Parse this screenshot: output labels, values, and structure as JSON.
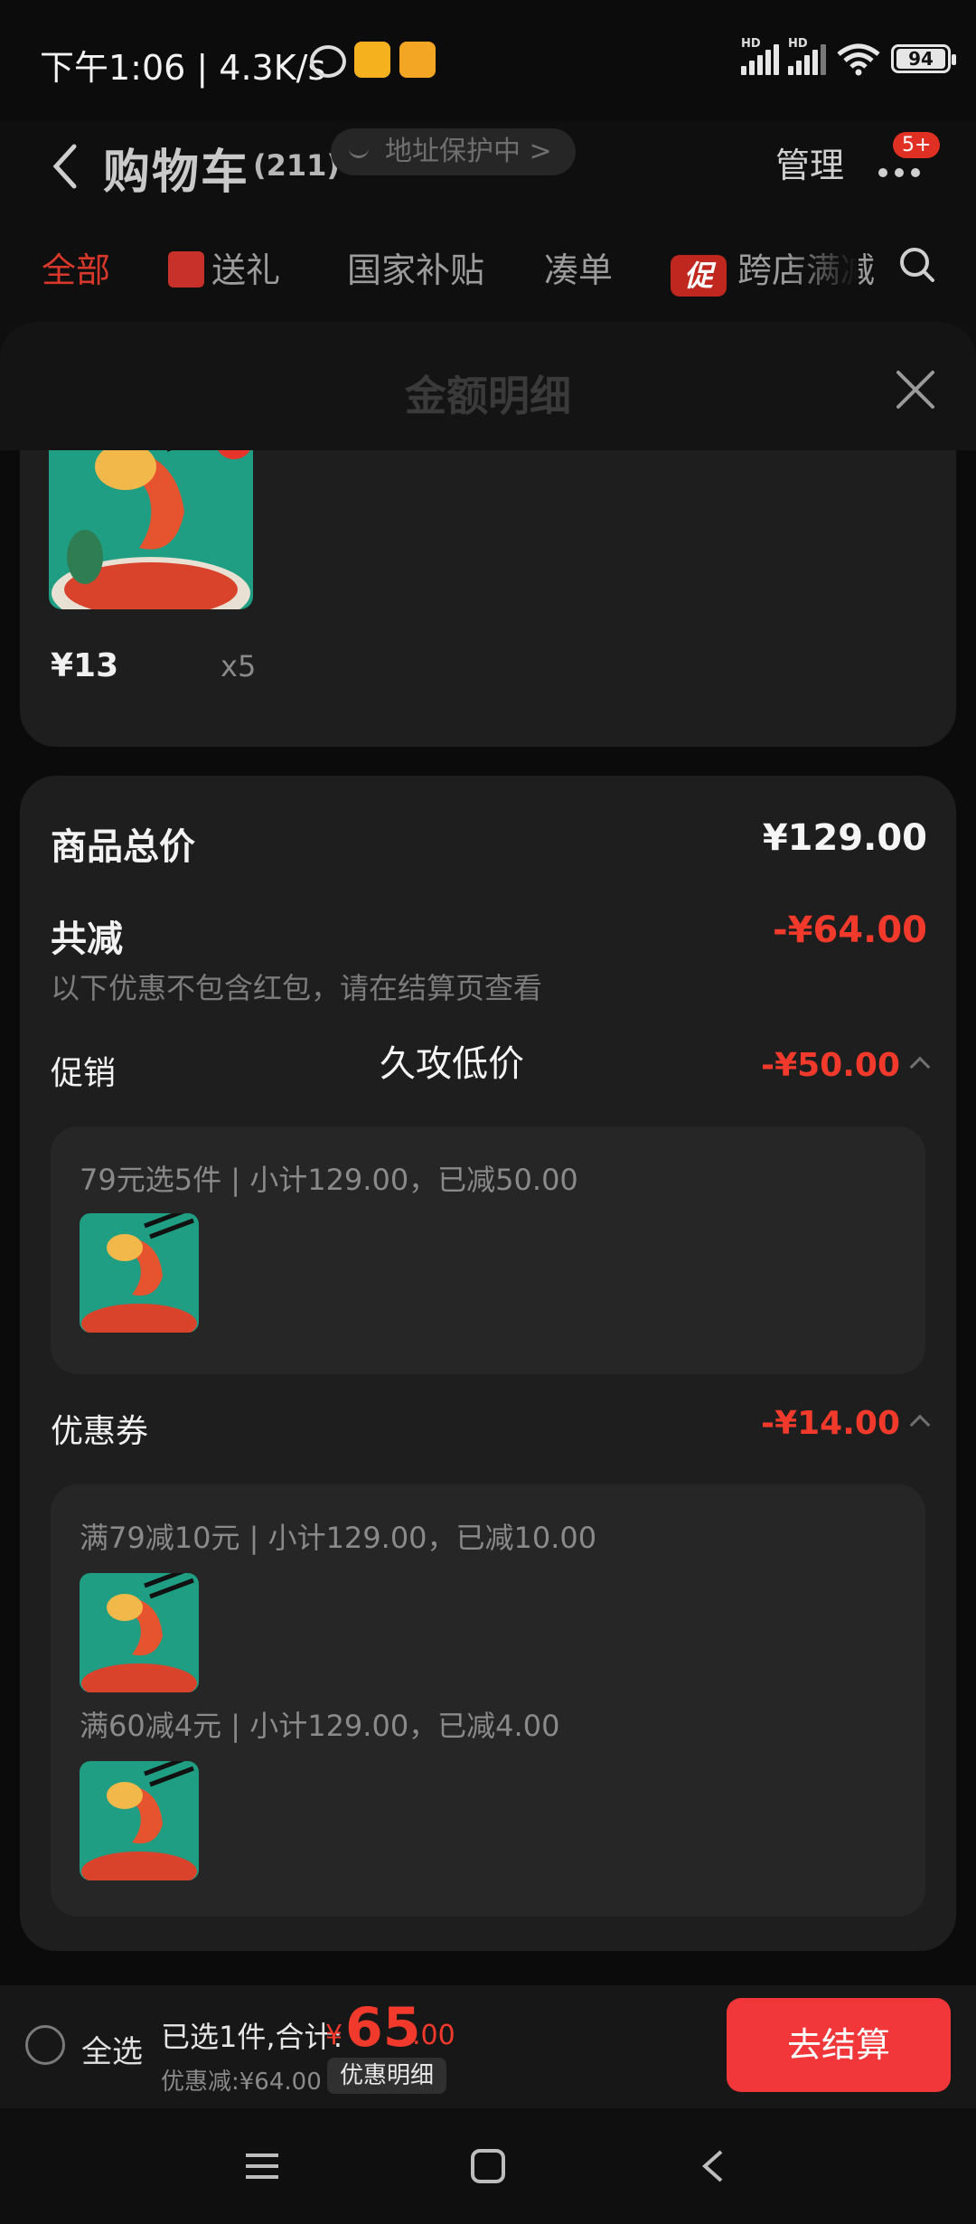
{
  "status_bar": {
    "time_and_speed": "下午1:06 | 4.3K/s",
    "battery": "94"
  },
  "header": {
    "title": "购物车",
    "count": "(211)",
    "address_protection": "地址保护中 >",
    "manage": "管理",
    "badge": "5+"
  },
  "tabs": [
    {
      "label": "全部"
    },
    {
      "label": "送礼"
    },
    {
      "label": "国家补贴"
    },
    {
      "label": "凑单"
    },
    {
      "label": "跨店满减",
      "chip": "促"
    }
  ],
  "sheet": {
    "title": "金额明细",
    "item": {
      "price": "¥13",
      "qty": "x5"
    },
    "total_label": "商品总价",
    "total_value": "¥129.00",
    "reduce_label": "共减",
    "reduce_value": "-¥64.00",
    "reduce_note": "以下优惠不包含红包，请在结算页查看",
    "floating_text": "久攻低价",
    "promo_label": "促销",
    "promo_value": "-¥50.00",
    "promo_line": "79元选5件 | 小计129.00，已减50.00",
    "coupon_label": "优惠券",
    "coupon_value": "-¥14.00",
    "coupon_lines": [
      "满79减10元 | 小计129.00，已减10.00",
      "满60减4元 | 小计129.00，已减4.00"
    ]
  },
  "bottom_bar": {
    "select_all": "全选",
    "summary": "已选1件,合计:",
    "currency": "¥",
    "total_int": "65",
    "total_dec": ".00",
    "discount": "优惠减:¥64.00",
    "detail_button": "优惠明细",
    "checkout": "去结算"
  },
  "colors": {
    "accent_red": "#f23a2c",
    "checkout_red": "#f2373a",
    "background": "#0f0f0f",
    "card": "#1e1e1e"
  }
}
